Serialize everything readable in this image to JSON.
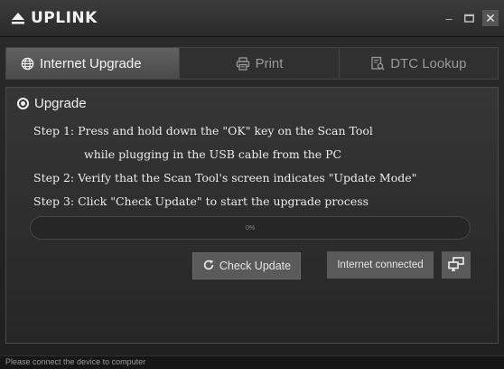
{
  "app": {
    "name": "UPLINK"
  },
  "window_controls": {
    "minimize": "–",
    "maximize": "□",
    "close": "✕"
  },
  "tabs": [
    {
      "label": "Internet Upgrade",
      "icon": "globe-icon",
      "active": true
    },
    {
      "label": "Print",
      "icon": "printer-icon",
      "active": false
    },
    {
      "label": "DTC Lookup",
      "icon": "document-search-icon",
      "active": false
    }
  ],
  "upgrade": {
    "option_label": "Upgrade",
    "selected": true,
    "steps": [
      "Step 1: Press and hold down the \"OK\" key on the Scan Tool",
      "while plugging in the USB cable from the PC",
      "Step 2: Verify that the Scan Tool's screen indicates \"Update Mode\"",
      "Step 3: Click \"Check Update\" to start the upgrade process"
    ],
    "progress_text": "0%",
    "progress_value": 0,
    "check_update_label": "Check Update",
    "connection_status": "Internet connected",
    "network_icon": "network-computers-icon"
  },
  "status_bar": {
    "message": "Please connect the device to computer"
  },
  "colors": {
    "background": "#1f1f1f",
    "active_tab": "#555555",
    "button": "#5a5a5a",
    "text": "#e8e8e8"
  }
}
